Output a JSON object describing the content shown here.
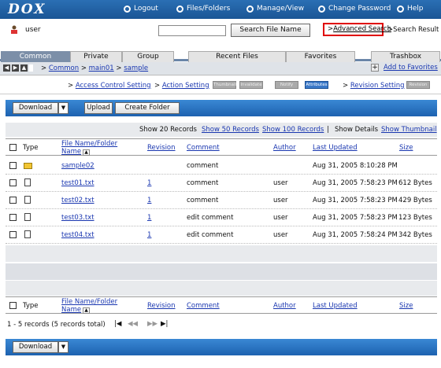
{
  "brand": {
    "logo": "DOX"
  },
  "topnav": [
    {
      "label": "Logout",
      "icon": "logout-icon"
    },
    {
      "label": "Files/Folders",
      "icon": "files-icon"
    },
    {
      "label": "Manage/View",
      "icon": "manage-icon"
    },
    {
      "label": "Change Password",
      "icon": "refresh-icon"
    },
    {
      "label": "Help",
      "icon": "help-icon"
    }
  ],
  "user": {
    "name": "user"
  },
  "search": {
    "value": "",
    "button": "Search File Name",
    "advanced": "Advanced Search",
    "result": "Search Result"
  },
  "tabs": [
    "Common",
    "Private",
    "Group",
    "Recent Files",
    "Favorites",
    "Trashbox"
  ],
  "breadcrumb": [
    "Common",
    "main01",
    "sample"
  ],
  "favorites": {
    "add": "Add to Favorites"
  },
  "settings": {
    "access": "Access Control Setting",
    "action": "Action Setting",
    "pills": [
      "Thumbnail",
      "Invalidate",
      "Notify",
      "Attributes"
    ],
    "revision": "Revision Setting",
    "revise": "Revision"
  },
  "toolbar": {
    "download": "Download",
    "upload": "Upload",
    "create_folder": "Create Folder"
  },
  "records_bar": {
    "show20": "Show 20 Records",
    "show50": "Show 50 Records",
    "show100": "Show 100 Records",
    "sep": "|",
    "details": "Show Details",
    "thumbnail": "Show Thumbnail"
  },
  "columns": {
    "type": "Type",
    "name": "File Name/Folder Name",
    "name1": "File Name/Folder",
    "name2": "Name",
    "revision": "Revision",
    "comment": "Comment",
    "author": "Author",
    "updated": "Last Updated",
    "size": "Size"
  },
  "rows": [
    {
      "kind": "folder",
      "name": "sample02",
      "revision": "",
      "comment": "comment",
      "author": "",
      "updated": "Aug 31, 2005 8:10:28 PM",
      "size": ""
    },
    {
      "kind": "file",
      "name": "test01.txt",
      "revision": "1",
      "comment": "comment",
      "author": "user",
      "updated": "Aug 31, 2005 7:58:23 PM",
      "size": "612 Bytes"
    },
    {
      "kind": "file",
      "name": "test02.txt",
      "revision": "1",
      "comment": "comment",
      "author": "user",
      "updated": "Aug 31, 2005 7:58:23 PM",
      "size": "429 Bytes"
    },
    {
      "kind": "file",
      "name": "test03.txt",
      "revision": "1",
      "comment": "edit comment",
      "author": "user",
      "updated": "Aug 31, 2005 7:58:23 PM",
      "size": "123 Bytes"
    },
    {
      "kind": "file",
      "name": "test04.txt",
      "revision": "1",
      "comment": "edit comment",
      "author": "user",
      "updated": "Aug 31, 2005 7:58:24 PM",
      "size": "342 Bytes"
    }
  ],
  "pager": {
    "summary": "1 - 5 records (5 records total)"
  },
  "colors": {
    "accent": "#1d62b0",
    "alert": "#e00000",
    "link": "#1a37b0"
  }
}
